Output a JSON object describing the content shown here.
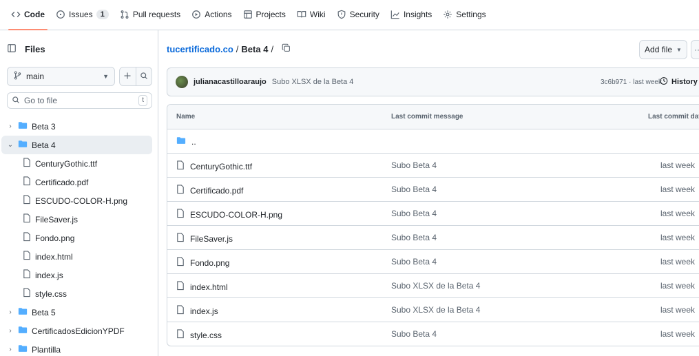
{
  "topnav": {
    "tabs": [
      {
        "label": "Code",
        "icon": "code-icon",
        "active": true
      },
      {
        "label": "Issues",
        "icon": "issue-icon",
        "count": "1"
      },
      {
        "label": "Pull requests",
        "icon": "pull-request-icon"
      },
      {
        "label": "Actions",
        "icon": "play-icon"
      },
      {
        "label": "Projects",
        "icon": "table-icon"
      },
      {
        "label": "Wiki",
        "icon": "book-icon"
      },
      {
        "label": "Security",
        "icon": "shield-icon"
      },
      {
        "label": "Insights",
        "icon": "graph-icon"
      },
      {
        "label": "Settings",
        "icon": "gear-icon"
      }
    ]
  },
  "sidebar": {
    "title": "Files",
    "branch": "main",
    "search_placeholder": "Go to file",
    "search_shortcut": "t",
    "tree": [
      {
        "label": "Beta 3",
        "type": "folder",
        "level": 0,
        "expanded": false
      },
      {
        "label": "Beta 4",
        "type": "folder",
        "level": 0,
        "expanded": true,
        "selected": true
      },
      {
        "label": "CenturyGothic.ttf",
        "type": "file",
        "level": 1
      },
      {
        "label": "Certificado.pdf",
        "type": "file",
        "level": 1
      },
      {
        "label": "ESCUDO-COLOR-H.png",
        "type": "file",
        "level": 1
      },
      {
        "label": "FileSaver.js",
        "type": "file",
        "level": 1
      },
      {
        "label": "Fondo.png",
        "type": "file",
        "level": 1
      },
      {
        "label": "index.html",
        "type": "file",
        "level": 1
      },
      {
        "label": "index.js",
        "type": "file",
        "level": 1
      },
      {
        "label": "style.css",
        "type": "file",
        "level": 1
      },
      {
        "label": "Beta 5",
        "type": "folder",
        "level": 0,
        "expanded": false
      },
      {
        "label": "CertificadosEdicionYPDF",
        "type": "folder",
        "level": 0,
        "expanded": false
      },
      {
        "label": "Plantilla",
        "type": "folder",
        "level": 0,
        "expanded": false
      }
    ]
  },
  "main": {
    "breadcrumb": {
      "repo": "tucertificado.co",
      "separator": "/",
      "current": "Beta 4",
      "trailing": "/"
    },
    "add_file_label": "Add file",
    "commit": {
      "author": "julianacastilloaraujo",
      "message": "Subo XLSX de la Beta 4",
      "sha_and_time": "3c6b971 · last week",
      "history_label": "History"
    },
    "table": {
      "headers": {
        "name": "Name",
        "message": "Last commit message",
        "date": "Last commit date"
      },
      "parent_row": "..",
      "rows": [
        {
          "name": "CenturyGothic.ttf",
          "message": "Subo Beta 4",
          "date": "last week"
        },
        {
          "name": "Certificado.pdf",
          "message": "Subo Beta 4",
          "date": "last week"
        },
        {
          "name": "ESCUDO-COLOR-H.png",
          "message": "Subo Beta 4",
          "date": "last week"
        },
        {
          "name": "FileSaver.js",
          "message": "Subo Beta 4",
          "date": "last week"
        },
        {
          "name": "Fondo.png",
          "message": "Subo Beta 4",
          "date": "last week"
        },
        {
          "name": "index.html",
          "message": "Subo XLSX de la Beta 4",
          "date": "last week"
        },
        {
          "name": "index.js",
          "message": "Subo XLSX de la Beta 4",
          "date": "last week"
        },
        {
          "name": "style.css",
          "message": "Subo Beta 4",
          "date": "last week"
        }
      ]
    }
  },
  "colors": {
    "link": "#0969da",
    "folder": "#54aeff",
    "active_tab_underline": "#fd8c73",
    "border": "#d0d7de",
    "muted": "#59636e"
  }
}
